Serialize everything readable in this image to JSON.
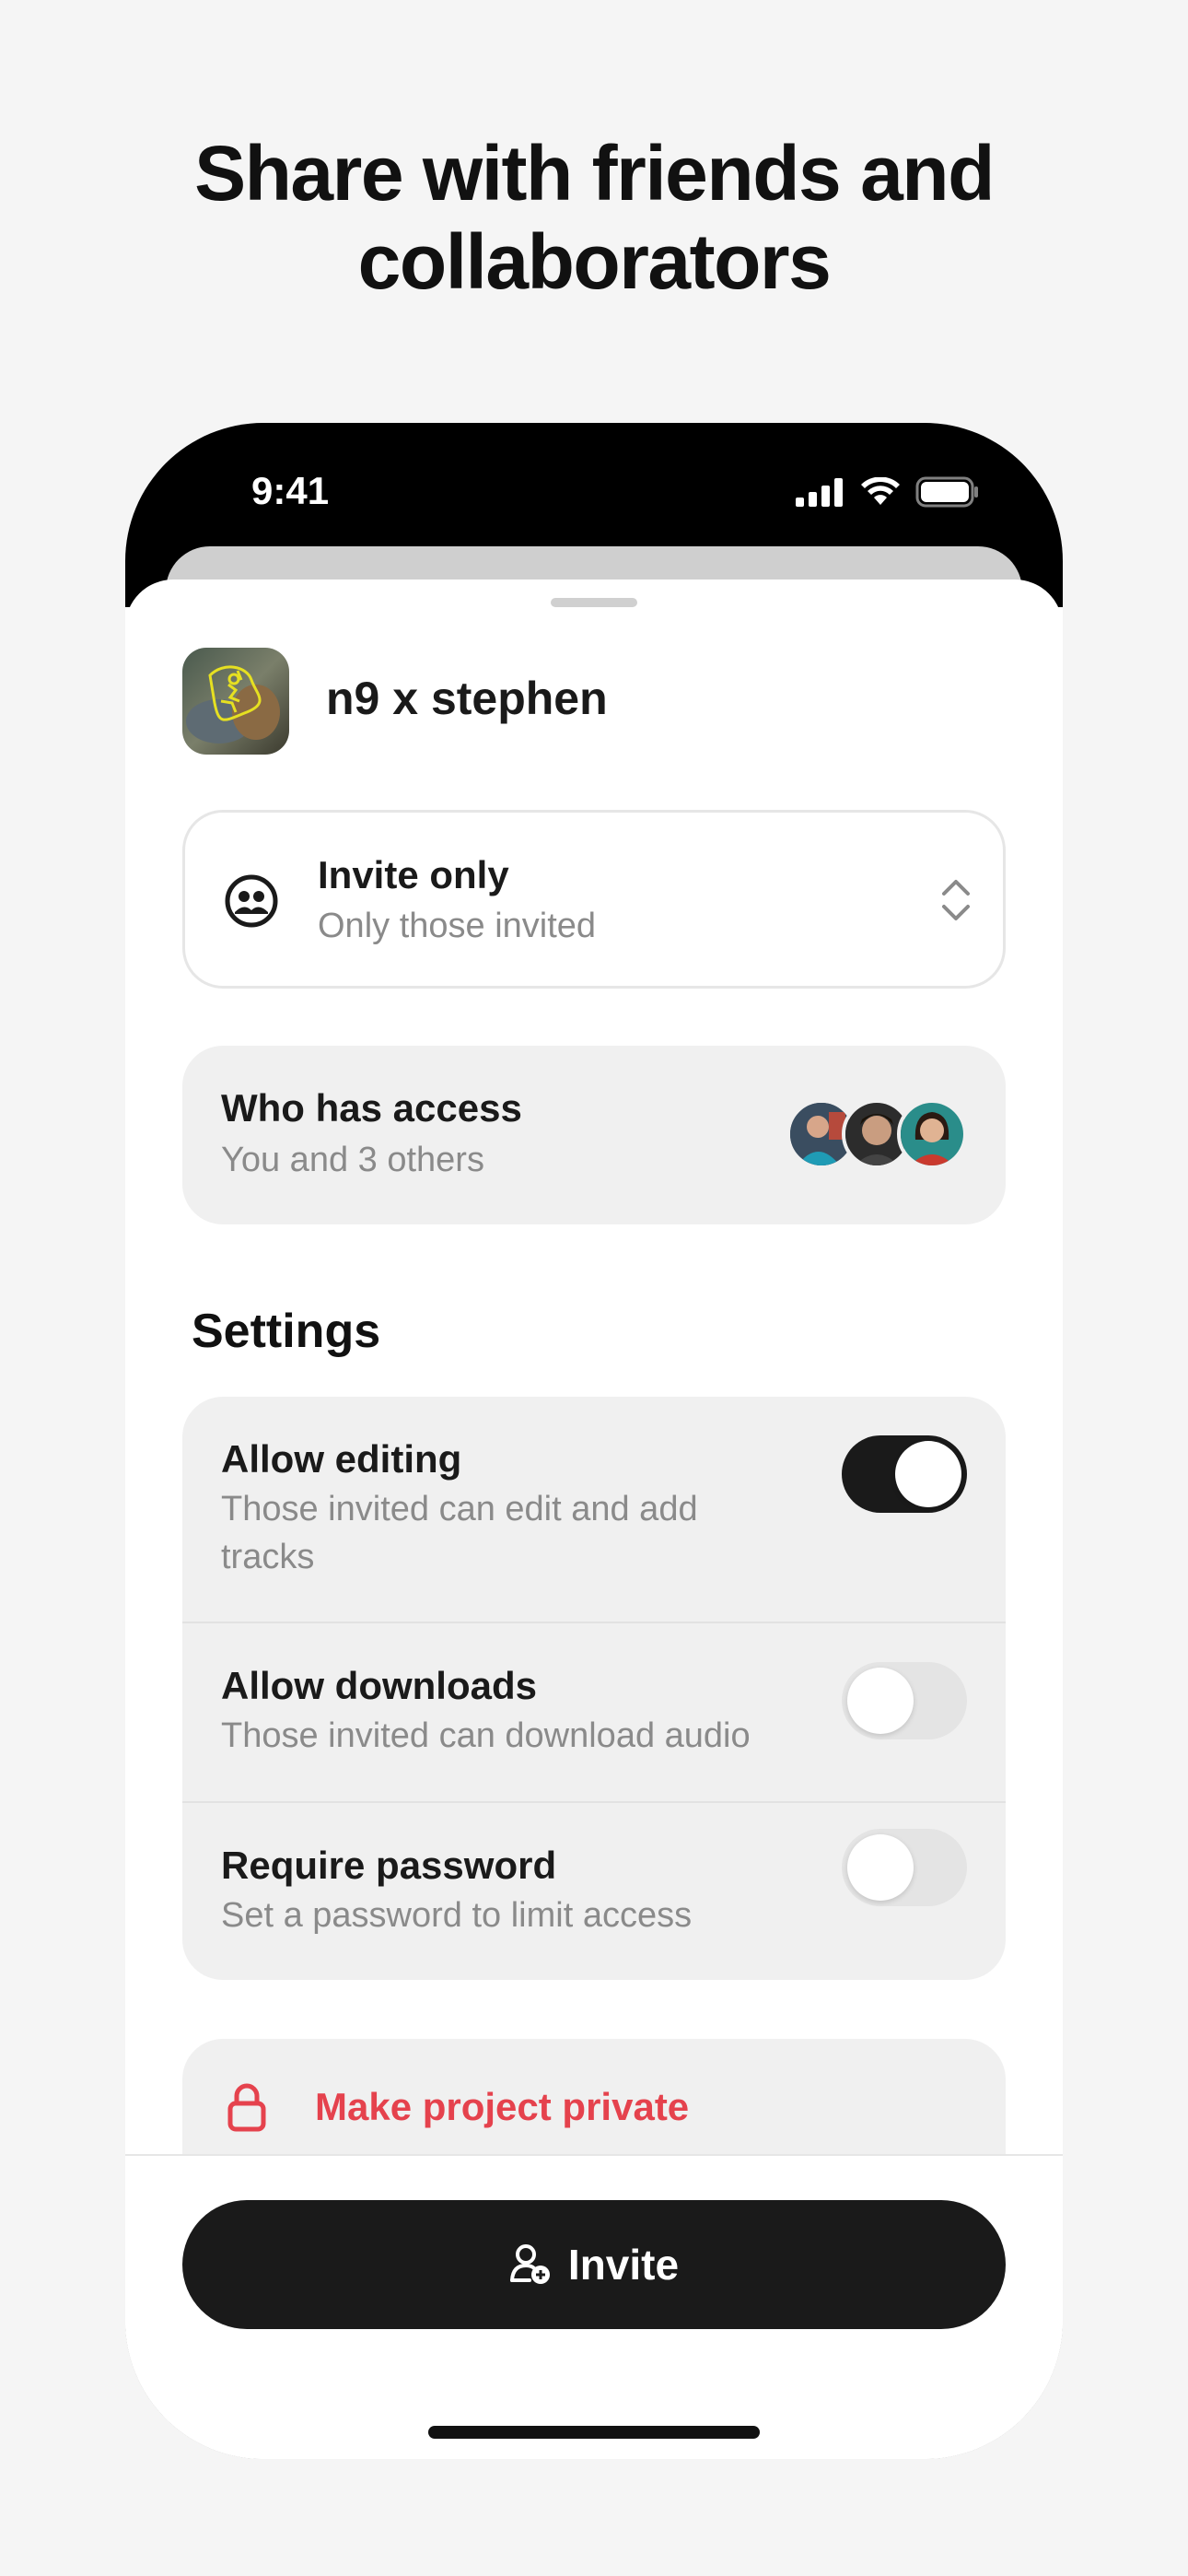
{
  "headline": {
    "line1": "Share with friends and",
    "line2": "collaborators"
  },
  "status_bar": {
    "time": "9:41",
    "icons": [
      "signal-icon",
      "wifi-icon",
      "battery-icon"
    ]
  },
  "project": {
    "title": "n9 x stephen",
    "artwork": "project-artwork"
  },
  "access_select": {
    "icon": "people-circle-icon",
    "title": "Invite only",
    "subtitle": "Only those invited",
    "chevron_icon": "chevron-up-down-icon"
  },
  "who_has_access": {
    "title": "Who has access",
    "subtitle": "You and 3 others",
    "avatars": [
      "avatar-1",
      "avatar-2",
      "avatar-3"
    ]
  },
  "settings": {
    "heading": "Settings",
    "items": [
      {
        "title": "Allow editing",
        "subtitle": "Those invited can edit and add tracks",
        "enabled": true
      },
      {
        "title": "Allow downloads",
        "subtitle": "Those invited can download audio",
        "enabled": false
      },
      {
        "title": "Require password",
        "subtitle": "Set a password to limit access",
        "enabled": false
      }
    ]
  },
  "private_action": {
    "icon": "lock-icon",
    "label": "Make project private",
    "color": "#e5424d"
  },
  "invite_button": {
    "icon": "add-person-icon",
    "label": "Invite"
  },
  "colors": {
    "background": "#f5f5f5",
    "primary": "#1a1a1a",
    "danger": "#e5424d",
    "muted_text": "#8a8a8a",
    "card": "#f0f0f0"
  }
}
